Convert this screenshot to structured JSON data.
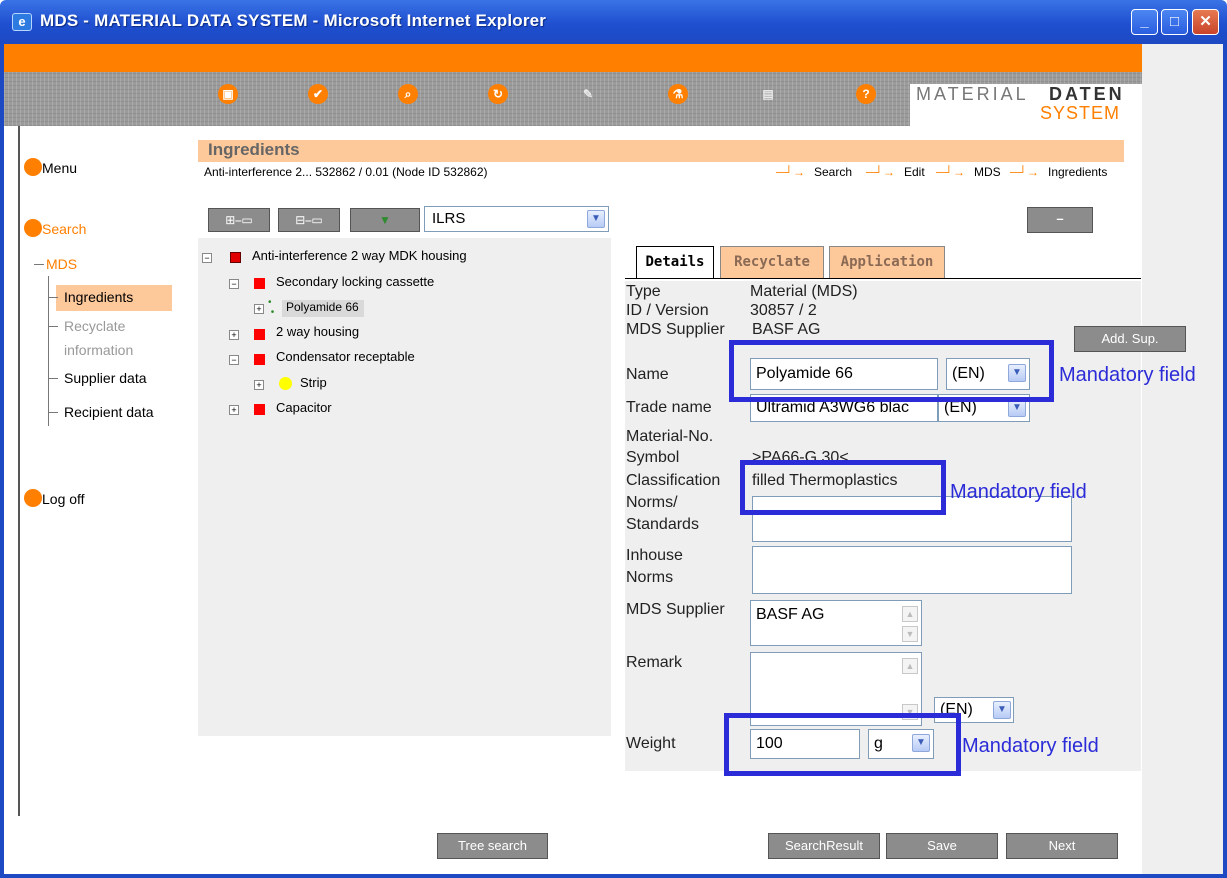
{
  "window": {
    "title": "MDS - MATERIAL DATA SYSTEM - Microsoft Internet Explorer",
    "min": "_",
    "max": "□",
    "close": "✕"
  },
  "brand": {
    "word1": "MATERIAL",
    "word2": "DATEN",
    "word3": "SYSTEM"
  },
  "toolbar": {
    "icons": [
      "save-icon",
      "check-icon",
      "search-icon",
      "refresh-icon",
      "pen-icon",
      "flask-icon",
      "print-icon",
      "help-icon"
    ],
    "glyphs": [
      "▣",
      "✔",
      "⌕",
      "↻",
      "✎",
      "⚗",
      "▤",
      "?"
    ]
  },
  "nav": {
    "menu": "Menu",
    "search": "Search",
    "mds": "MDS",
    "ingredients": "Ingredients",
    "recycle1": "Recyclate",
    "recycle2": "information",
    "supplier": "Supplier data",
    "recipient": "Recipient data",
    "logoff": "Log off"
  },
  "header": {
    "title": "Ingredients",
    "node": "Anti-interference 2... 532862 / 0.01 (Node ID 532862)",
    "breadcrumb": [
      "Search",
      "Edit",
      "MDS",
      "Ingredients"
    ],
    "arrow": "─┘→"
  },
  "tree_toolbar": {
    "select_value": "ILRS",
    "btn1": "⊞⎯▭",
    "btn2": "⊟⎯▭",
    "btn3": "▼"
  },
  "tree": [
    {
      "label": "Anti-interference 2 way MDK housing"
    },
    {
      "label": "Secondary locking cassette"
    },
    {
      "label": "Polyamide 66"
    },
    {
      "label": "2 way housing"
    },
    {
      "label": "Condensator receptable"
    },
    {
      "label": "Strip"
    },
    {
      "label": "Capacitor"
    }
  ],
  "tabs": {
    "details": "Details",
    "recycle": "Recyclate",
    "application": "Application"
  },
  "details": {
    "type_label": "Type",
    "type_value": "Material (MDS)",
    "id_label": "ID / Version",
    "id_value": "30857 / 2",
    "supplier_label": "MDS Supplier",
    "supplier_value": "BASF AG",
    "add_sup": "Add. Sup.",
    "name_label": "Name",
    "name_value": "Polyamide 66",
    "name_lang": "(EN)",
    "trade_label": "Trade name",
    "trade_value": "Ultramid A3WG6 blac",
    "trade_lang": "(EN)",
    "matno_label": "Material-No.",
    "symbol_label": "Symbol",
    "symbol_value": ">PA66-G 30<",
    "class_label": "Classification",
    "class_value": "filled Thermoplastics",
    "norms_label1": "Norms/",
    "norms_label2": "Standards",
    "inhouse_label1": "Inhouse",
    "inhouse_label2": "Norms",
    "supplier2_label": "Supplier",
    "supplier2_value": "BASF AG",
    "remark_label": "Remark",
    "remark_lang": "(EN)",
    "weight_label": "Weight",
    "weight_value": "100",
    "weight_unit": "g"
  },
  "annotations": {
    "mandatory": "Mandatory field"
  },
  "buttons": {
    "tree_search": "Tree search",
    "search_result": "SearchResult",
    "save": "Save",
    "next": "Next"
  },
  "colors": {
    "orange": "#ff7f00",
    "peach": "#fdc89a",
    "annotation": "#2b2bd8",
    "xp_blue": "#1f4fd0"
  }
}
